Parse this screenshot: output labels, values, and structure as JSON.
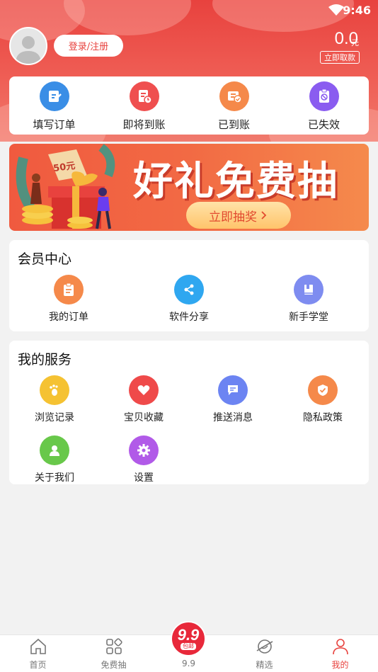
{
  "status_bar": {
    "time": "9:46"
  },
  "header": {
    "login_label": "登录/注册",
    "balance": "0.0",
    "balance_unit": "元",
    "withdraw_label": "立即取款"
  },
  "orders": [
    {
      "label": "填写订单",
      "icon": "edit-order-icon",
      "color": "#3a8ee6"
    },
    {
      "label": "即将到账",
      "icon": "pending-icon",
      "color": "#ef4f4f"
    },
    {
      "label": "已到账",
      "icon": "received-icon",
      "color": "#f5894a"
    },
    {
      "label": "已失效",
      "icon": "expired-icon",
      "color": "#8a5cf0"
    }
  ],
  "banner": {
    "title": "好礼免费抽",
    "button": "立即抽奖",
    "coupon": "50元"
  },
  "member_center": {
    "title": "会员中心",
    "items": [
      {
        "label": "我的订单",
        "icon": "clipboard-icon",
        "color": "#f5894a"
      },
      {
        "label": "软件分享",
        "icon": "share-icon",
        "color": "#2fa7f0"
      },
      {
        "label": "新手学堂",
        "icon": "book-icon",
        "color": "#7e8cf0"
      }
    ]
  },
  "my_services": {
    "title": "我的服务",
    "items": [
      {
        "label": "浏览记录",
        "icon": "footprint-icon",
        "color": "#f5c232"
      },
      {
        "label": "宝贝收藏",
        "icon": "heart-icon",
        "color": "#ef4a4a"
      },
      {
        "label": "推送消息",
        "icon": "message-icon",
        "color": "#6c84f2"
      },
      {
        "label": "隐私政策",
        "icon": "shield-icon",
        "color": "#f5894a"
      },
      {
        "label": "关于我们",
        "icon": "person-icon",
        "color": "#68c84a"
      },
      {
        "label": "设置",
        "icon": "gear-icon",
        "color": "#b15ae8"
      }
    ]
  },
  "tabbar": {
    "tabs": [
      {
        "label": "首页",
        "icon": "home-icon"
      },
      {
        "label": "免费抽",
        "icon": "grid-icon"
      },
      {
        "label": "9.9",
        "icon": "nine-nine-icon"
      },
      {
        "label": "精选",
        "icon": "planet-icon"
      },
      {
        "label": "我的",
        "icon": "profile-icon",
        "active": true
      }
    ],
    "badge_number": "9.9",
    "badge_sub": "包邮"
  }
}
